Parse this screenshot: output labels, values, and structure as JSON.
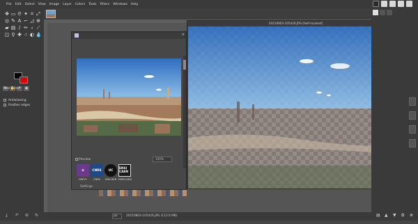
{
  "menu": [
    "File",
    "Edit",
    "Select",
    "View",
    "Image",
    "Layer",
    "Colors",
    "Tools",
    "Filters",
    "Windows",
    "Help"
  ],
  "tool_options": {
    "title": "Free Select",
    "antialiasing": "Antialiasing",
    "feather_edges": "Feather edges"
  },
  "dialog": {
    "preview_label": "Preview",
    "zoom_value": "100%",
    "settings_label": "Settings",
    "logos": [
      {
        "text": "GREYC",
        "bg": "#6b3a8c"
      },
      {
        "text": "CNRS",
        "bg": "#1f4a8a"
      },
      {
        "text": "UNICAEN",
        "bg": "#111111"
      },
      {
        "text": "ENSI CAEN",
        "bg": "#1a1a1a"
      }
    ],
    "logo_labels": [
      "GREYC",
      "CNRS",
      "UNICAEN",
      "ENSICAEN"
    ]
  },
  "image_window": {
    "title": "20210803-105426.JPG-[Self-masked]"
  },
  "status": {
    "unit": "px",
    "filename": "20210803-105426.JPG (113.6 MB)"
  },
  "colors": {
    "fg": "#000000",
    "bg": "#e10000"
  }
}
